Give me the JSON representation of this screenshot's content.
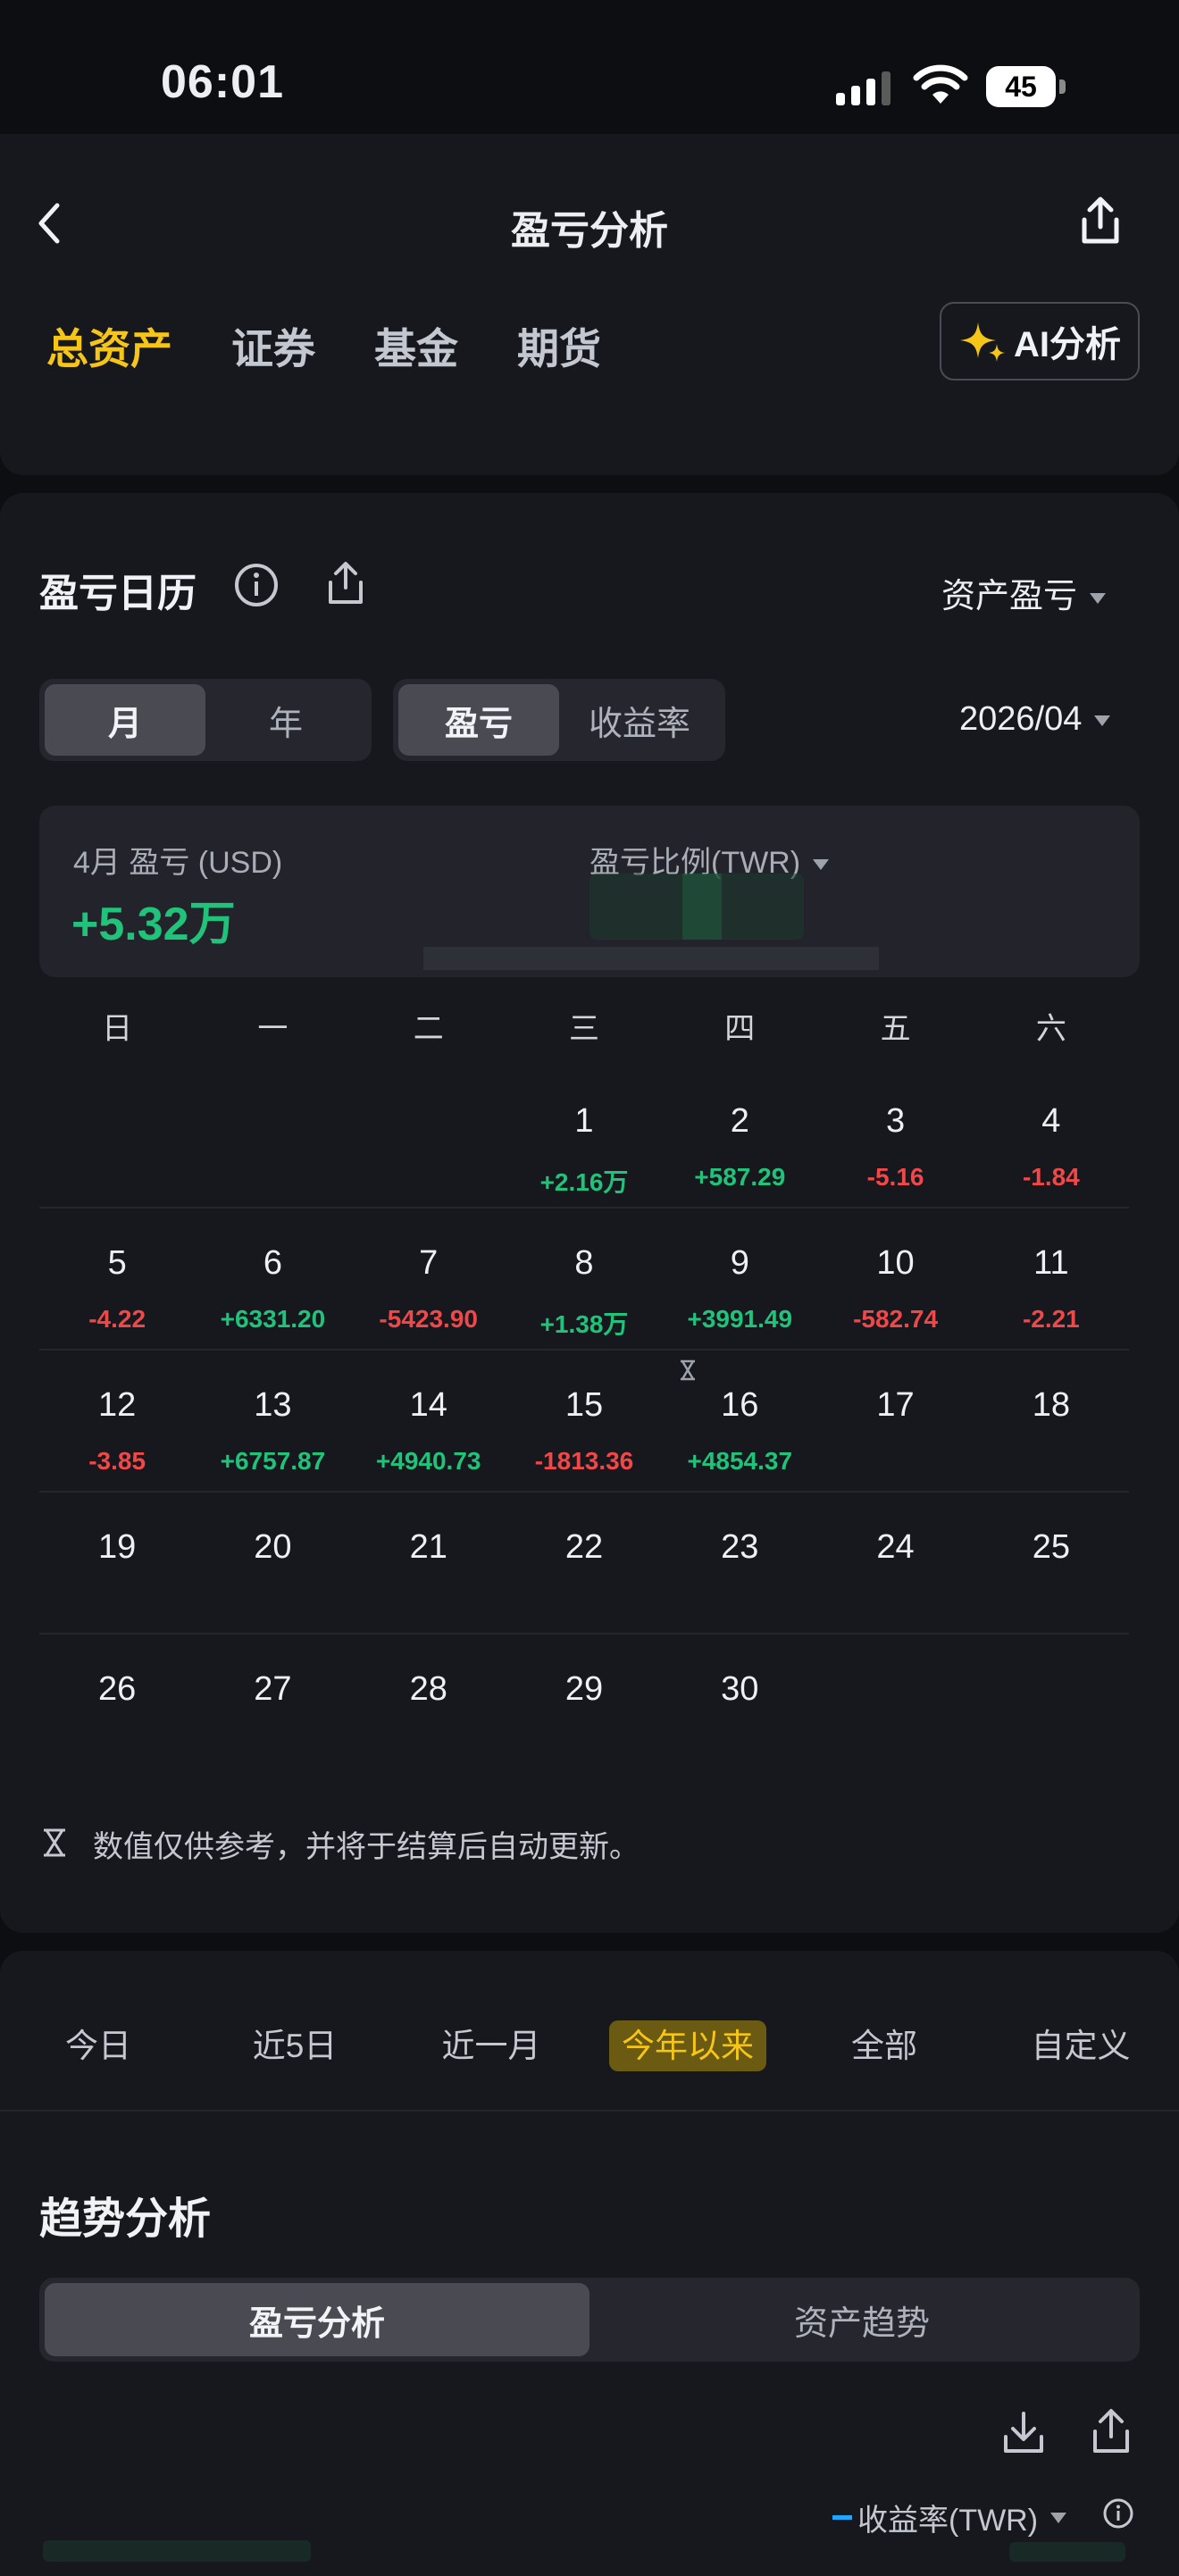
{
  "status_bar": {
    "time": "06:01",
    "battery": "45"
  },
  "header": {
    "title": "盈亏分析",
    "tabs": [
      "总资产",
      "证券",
      "基金",
      "期货"
    ],
    "active_tab": 0,
    "ai_button": "AI分析"
  },
  "calendar": {
    "title": "盈亏日历",
    "asset_selector": "资产盈亏",
    "period_seg": [
      "月",
      "年"
    ],
    "metric_seg": [
      "盈亏",
      "收益率"
    ],
    "date_selector": "2026/04",
    "summary_label": "4月 盈亏 (USD)",
    "summary_value": "+5.32万",
    "ratio_label": "盈亏比例(TWR)",
    "weekdays": [
      "日",
      "一",
      "二",
      "三",
      "四",
      "五",
      "六"
    ],
    "weeks": [
      [
        {
          "d": "",
          "v": ""
        },
        {
          "d": "",
          "v": ""
        },
        {
          "d": "",
          "v": ""
        },
        {
          "d": "1",
          "v": "+2.16万"
        },
        {
          "d": "2",
          "v": "+587.29"
        },
        {
          "d": "3",
          "v": "-5.16"
        },
        {
          "d": "4",
          "v": "-1.84"
        }
      ],
      [
        {
          "d": "5",
          "v": "-4.22"
        },
        {
          "d": "6",
          "v": "+6331.20"
        },
        {
          "d": "7",
          "v": "-5423.90"
        },
        {
          "d": "8",
          "v": "+1.38万"
        },
        {
          "d": "9",
          "v": "+3991.49"
        },
        {
          "d": "10",
          "v": "-582.74"
        },
        {
          "d": "11",
          "v": "-2.21"
        }
      ],
      [
        {
          "d": "12",
          "v": "-3.85"
        },
        {
          "d": "13",
          "v": "+6757.87"
        },
        {
          "d": "14",
          "v": "+4940.73"
        },
        {
          "d": "15",
          "v": "-1813.36"
        },
        {
          "d": "16",
          "v": "+4854.37"
        },
        {
          "d": "17",
          "v": ""
        },
        {
          "d": "18",
          "v": ""
        }
      ],
      [
        {
          "d": "19",
          "v": ""
        },
        {
          "d": "20",
          "v": ""
        },
        {
          "d": "21",
          "v": ""
        },
        {
          "d": "22",
          "v": ""
        },
        {
          "d": "23",
          "v": ""
        },
        {
          "d": "24",
          "v": ""
        },
        {
          "d": "25",
          "v": ""
        }
      ],
      [
        {
          "d": "26",
          "v": ""
        },
        {
          "d": "27",
          "v": ""
        },
        {
          "d": "28",
          "v": ""
        },
        {
          "d": "29",
          "v": ""
        },
        {
          "d": "30",
          "v": ""
        },
        {
          "d": "",
          "v": ""
        },
        {
          "d": "",
          "v": ""
        }
      ]
    ],
    "footnote": "数值仅供参考，并将于结算后自动更新。"
  },
  "range_tabs": [
    "今日",
    "近5日",
    "近一月",
    "今年以来",
    "全部",
    "自定义"
  ],
  "range_active": 3,
  "trend": {
    "title": "趋势分析",
    "seg": [
      "盈亏分析",
      "资产趋势"
    ],
    "legend": "收益率(TWR)"
  },
  "colors": {
    "accent": "#f5c518",
    "positive": "#21c27a",
    "negative": "#f04848",
    "legend_line": "#1fa6ff"
  }
}
